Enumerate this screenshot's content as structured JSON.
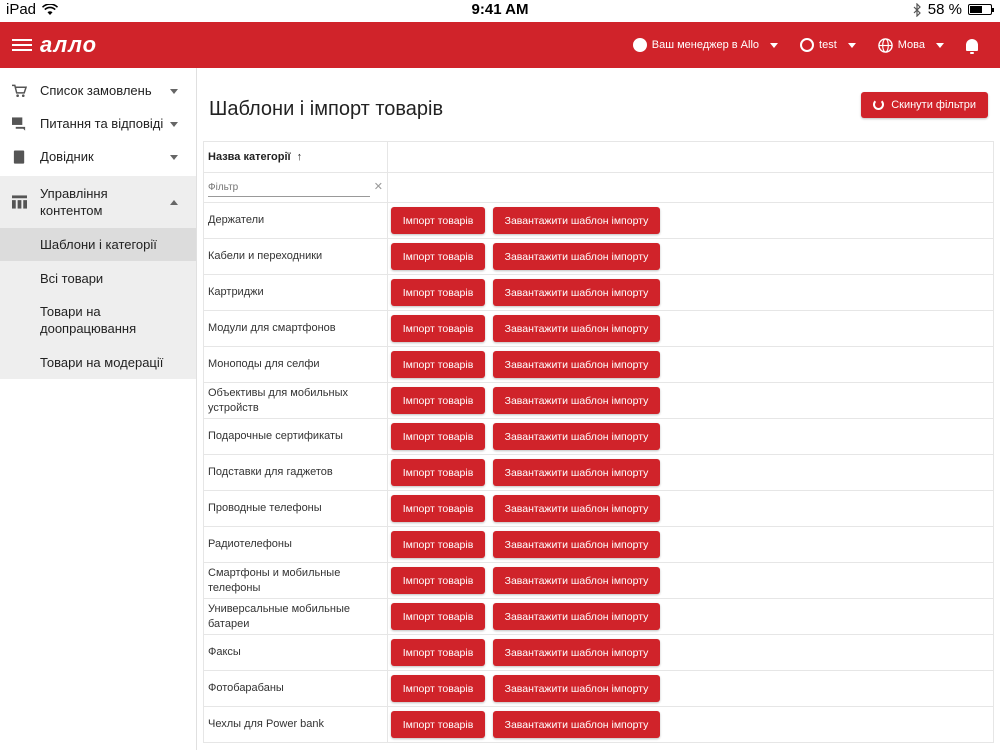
{
  "status_bar": {
    "device": "iPad",
    "time": "9:41 AM",
    "battery": "58 %",
    "battery_level": 0.58
  },
  "appbar": {
    "logo": "алло",
    "manager_label": "Ваш менеджер в Allo",
    "user_label": "test",
    "language_label": "Мова"
  },
  "sidebar": {
    "items": [
      {
        "label": "Список замовлень",
        "icon": "cart-icon"
      },
      {
        "label": "Питання та відповіді",
        "icon": "chat-icon"
      },
      {
        "label": "Довідник",
        "icon": "book-icon"
      }
    ],
    "group": {
      "label": "Управління контентом",
      "icon": "table-icon",
      "children": [
        {
          "label": "Шаблони і категорії",
          "active": true
        },
        {
          "label": "Всі товари",
          "active": false
        },
        {
          "label": "Товари на доопрацювання",
          "active": false
        },
        {
          "label": "Товари на модерації",
          "active": false
        }
      ]
    }
  },
  "main": {
    "title": "Шаблони і імпорт товарів",
    "reset_label": "Скинути фільтри",
    "column_header": "Назва категорії",
    "filter_placeholder": "Фільтр",
    "import_label": "Імпорт товарів",
    "download_label": "Завантажити шаблон імпорту",
    "categories": [
      "Держатели",
      "Кабели и переходники",
      "Картриджи",
      "Модули для смартфонов",
      "Моноподы для селфи",
      "Объективы для мобильных устройств",
      "Подарочные сертификаты",
      "Подставки для гаджетов",
      "Проводные телефоны",
      "Радиотелефоны",
      "Смартфоны и мобильные телефоны",
      "Универсальные мобильные батареи",
      "Факсы",
      "Фотобарабаны",
      "Чехлы для Power bank"
    ]
  },
  "colors": {
    "brand": "#d0232a"
  }
}
